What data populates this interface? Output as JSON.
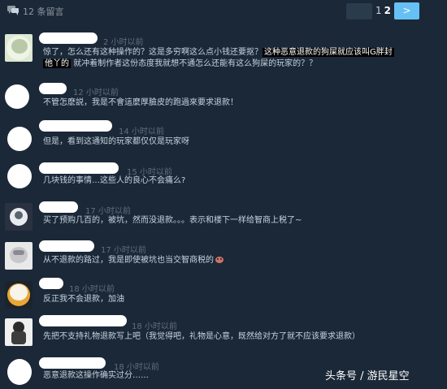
{
  "header": {
    "comment_count": "12 条留言",
    "page_current": "2",
    "page_prev": "1",
    "next_label": ">"
  },
  "comments": [
    {
      "time": "2 小时以前",
      "line1_pre": "惊了，怎么还有这种操作的？这是多穷啊这么点小钱还要抠？",
      "line1_hl": "这种恶意退款的狗屎就应该叫G胖封",
      "line2_hl": "他丫的",
      "line2_post": "就冲着制作者这份态度我就想不通怎么还能有这么狗屎的玩家的？？"
    },
    {
      "time": "12 小时以前",
      "text": "不管怎麽説，我是不會這麼厚臉皮的跑過來要求退款！"
    },
    {
      "time": "14 小时以前",
      "text": "但是，看到这通知的玩家都仅仅是玩家呀"
    },
    {
      "time": "15 小时以前",
      "text": "几块钱的事情…这些人的良心不会痛么?"
    },
    {
      "time": "17 小时以前",
      "text": "买了预购几百的，被坑，然而没退款。。。表示和楼下一样给智商上税了~"
    },
    {
      "time": "17 小时以前",
      "text": "从不退款的路过，我是即使被坑也当交智商税的"
    },
    {
      "time": "18 小时以前",
      "text": "反正我不会退款，加油"
    },
    {
      "time": "18 小时以前",
      "text": "先把不支持礼物退款写上吧（我觉得吧，礼物是心意，既然给对方了就不应该要求退款）"
    },
    {
      "time": "18 小时以前",
      "text": "恶意退款这操作确实过分……"
    }
  ],
  "watermark": "头条号 / 游民星空",
  "colors": {
    "background": "#1b2838",
    "button_blue": "#66c0f4",
    "text": "#c6d4df",
    "timestamp": "#626e79"
  }
}
